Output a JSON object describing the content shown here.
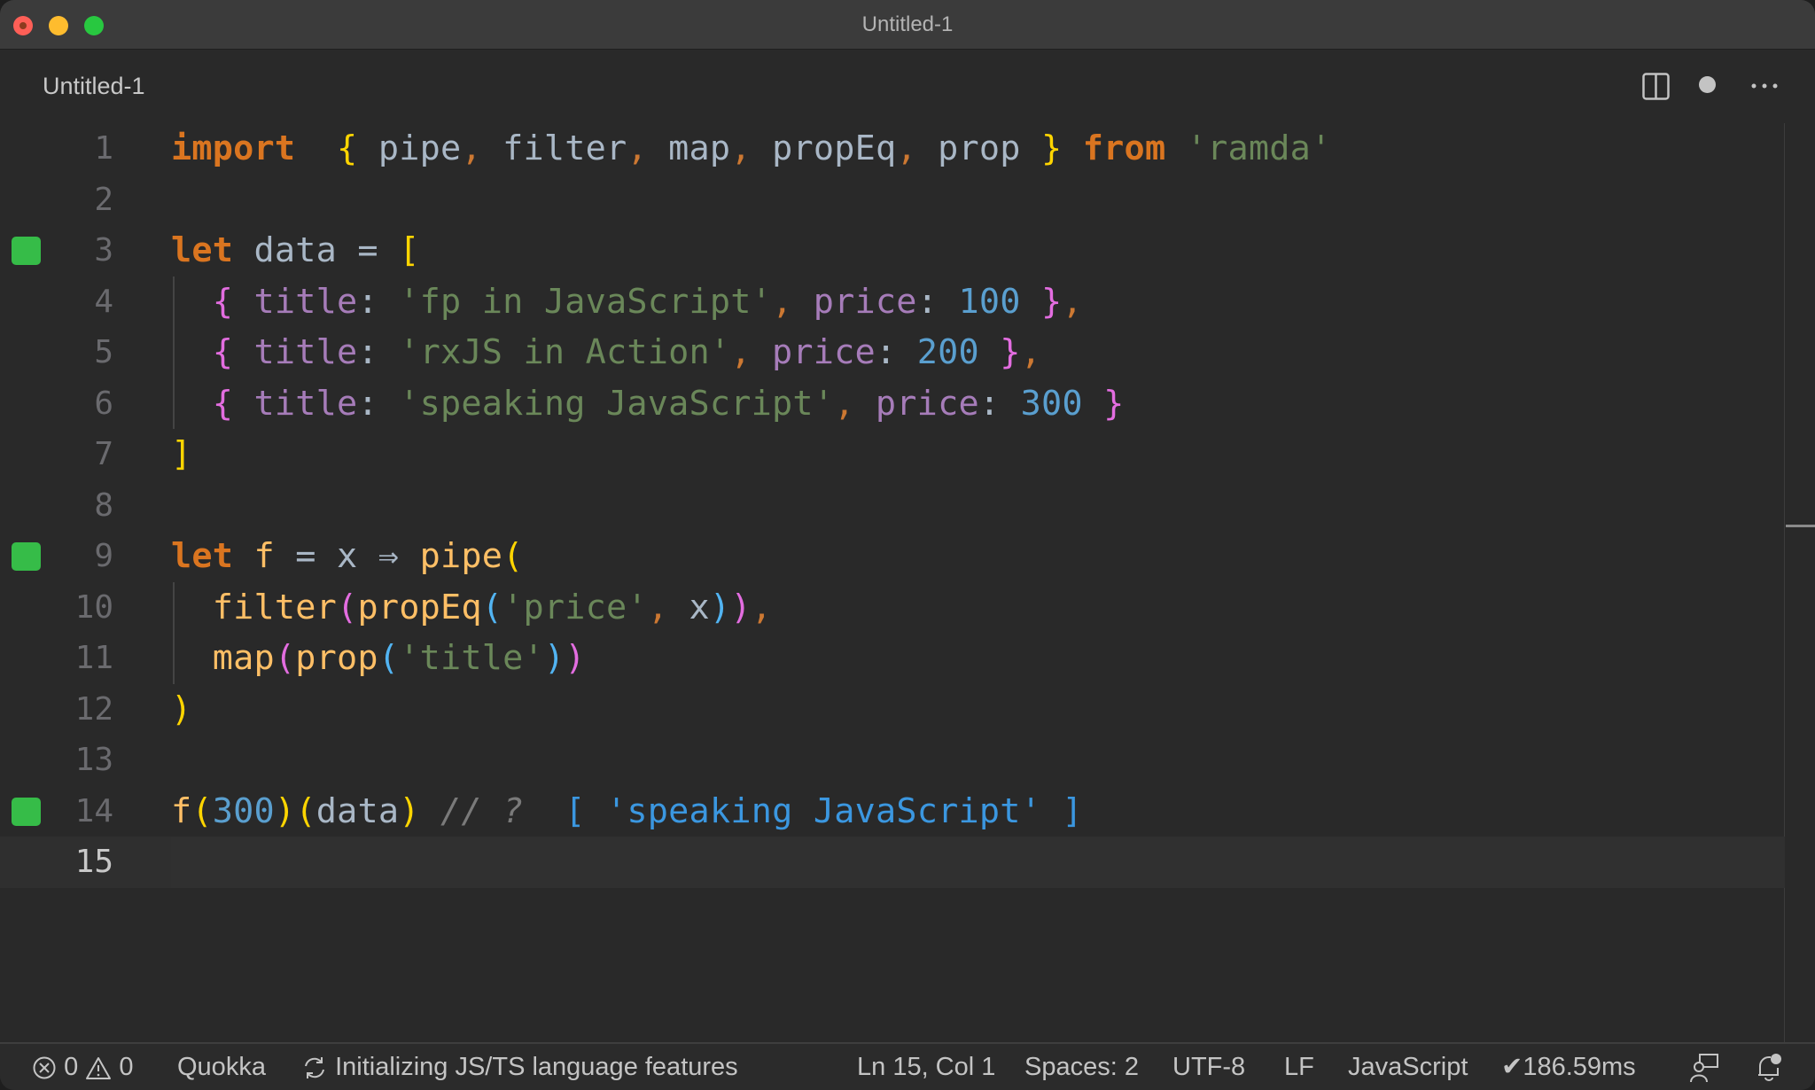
{
  "window": {
    "title": "Untitled-1"
  },
  "tab": {
    "label": "Untitled-1",
    "dirty": true
  },
  "tab_actions": [
    "split-editor",
    "unsaved-indicator",
    "more-actions"
  ],
  "editor": {
    "language": "JavaScript",
    "current_line": 15,
    "lines": [
      {
        "n": "1",
        "marker": false,
        "tokens": [
          [
            "kw",
            "import"
          ],
          [
            "",
            "  "
          ],
          [
            "br1",
            "{"
          ],
          [
            "id",
            " pipe"
          ],
          [
            "punc-c",
            ","
          ],
          [
            "id",
            " filter"
          ],
          [
            "punc-c",
            ","
          ],
          [
            "id",
            " map"
          ],
          [
            "punc-c",
            ","
          ],
          [
            "id",
            " propEq"
          ],
          [
            "punc-c",
            ","
          ],
          [
            "id",
            " prop "
          ],
          [
            "br1",
            "}"
          ],
          [
            "",
            ""
          ],
          [
            "kw",
            " from"
          ],
          [
            "str",
            " 'ramda'"
          ]
        ]
      },
      {
        "n": "2",
        "marker": false,
        "tokens": []
      },
      {
        "n": "3",
        "marker": true,
        "tokens": [
          [
            "kw",
            "let"
          ],
          [
            "id",
            " data "
          ],
          [
            "op",
            "="
          ],
          [
            "",
            ""
          ],
          [
            "br1",
            " ["
          ]
        ]
      },
      {
        "n": "4",
        "marker": false,
        "tokens": [
          [
            "br2",
            "  {"
          ],
          [
            "prop",
            " title"
          ],
          [
            "colon",
            ":"
          ],
          [
            "str",
            " 'fp in JavaScript'"
          ],
          [
            "punc-c",
            ","
          ],
          [
            "prop",
            " price"
          ],
          [
            "colon",
            ":"
          ],
          [
            "num",
            " 100"
          ],
          [
            "br2",
            " }"
          ],
          [
            "punc-c",
            ","
          ]
        ]
      },
      {
        "n": "5",
        "marker": false,
        "tokens": [
          [
            "br2",
            "  {"
          ],
          [
            "prop",
            " title"
          ],
          [
            "colon",
            ":"
          ],
          [
            "str",
            " 'rxJS in Action'"
          ],
          [
            "punc-c",
            ","
          ],
          [
            "prop",
            " price"
          ],
          [
            "colon",
            ":"
          ],
          [
            "num",
            " 200"
          ],
          [
            "br2",
            " }"
          ],
          [
            "punc-c",
            ","
          ]
        ]
      },
      {
        "n": "6",
        "marker": false,
        "tokens": [
          [
            "br2",
            "  {"
          ],
          [
            "prop",
            " title"
          ],
          [
            "colon",
            ":"
          ],
          [
            "str",
            " 'speaking JavaScript'"
          ],
          [
            "punc-c",
            ","
          ],
          [
            "prop",
            " price"
          ],
          [
            "colon",
            ":"
          ],
          [
            "num",
            " 300"
          ],
          [
            "br2",
            " }"
          ]
        ]
      },
      {
        "n": "7",
        "marker": false,
        "tokens": [
          [
            "br1",
            "]"
          ]
        ]
      },
      {
        "n": "8",
        "marker": false,
        "tokens": []
      },
      {
        "n": "9",
        "marker": true,
        "tokens": [
          [
            "kw",
            "let"
          ],
          [
            "fn",
            " f"
          ],
          [
            "op",
            " = x ⇒ "
          ],
          [
            "fn",
            "pipe"
          ],
          [
            "br1",
            "("
          ]
        ]
      },
      {
        "n": "10",
        "marker": false,
        "tokens": [
          [
            "fn",
            "  filter"
          ],
          [
            "br2",
            "("
          ],
          [
            "fn",
            "propEq"
          ],
          [
            "br3",
            "("
          ],
          [
            "str",
            "'price'"
          ],
          [
            "punc-c",
            ","
          ],
          [
            "id",
            " x"
          ],
          [
            "br3",
            ")"
          ],
          [
            "br2",
            ")"
          ],
          [
            "punc-c",
            ","
          ]
        ]
      },
      {
        "n": "11",
        "marker": false,
        "tokens": [
          [
            "fn",
            "  map"
          ],
          [
            "br2",
            "("
          ],
          [
            "fn",
            "prop"
          ],
          [
            "br3",
            "("
          ],
          [
            "str",
            "'title'"
          ],
          [
            "br3",
            ")"
          ],
          [
            "br2",
            ")"
          ]
        ]
      },
      {
        "n": "12",
        "marker": false,
        "tokens": [
          [
            "br1",
            ")"
          ]
        ]
      },
      {
        "n": "13",
        "marker": false,
        "tokens": []
      },
      {
        "n": "14",
        "marker": true,
        "tokens": [
          [
            "fn",
            "f"
          ],
          [
            "br1",
            "("
          ],
          [
            "num",
            "300"
          ],
          [
            "br1",
            ")"
          ],
          [
            "br1",
            "("
          ],
          [
            "id",
            "data"
          ],
          [
            "br1",
            ")"
          ],
          [
            "cmt",
            " // ? "
          ],
          [
            "result",
            " [ 'speaking JavaScript' ]"
          ]
        ]
      },
      {
        "n": "15",
        "marker": false,
        "tokens": []
      }
    ]
  },
  "statusbar": {
    "errors": "0",
    "warnings": "0",
    "quokka": "Quokka",
    "init_message": "Initializing JS/TS language features",
    "cursor": "Ln 15, Col 1",
    "spaces": "Spaces: 2",
    "encoding": "UTF-8",
    "eol": "LF",
    "language": "JavaScript",
    "timing": "186.59ms"
  },
  "colors": {
    "marker": "#36bc48",
    "keyword": "#da7520",
    "string": "#6a8759",
    "number": "#5a9fcf",
    "property": "#a67cb9",
    "function": "#ffbf66",
    "bracket1": "#ffd500",
    "bracket2": "#e36de0",
    "bracket3": "#52b4f2",
    "result": "#3b97e0"
  }
}
